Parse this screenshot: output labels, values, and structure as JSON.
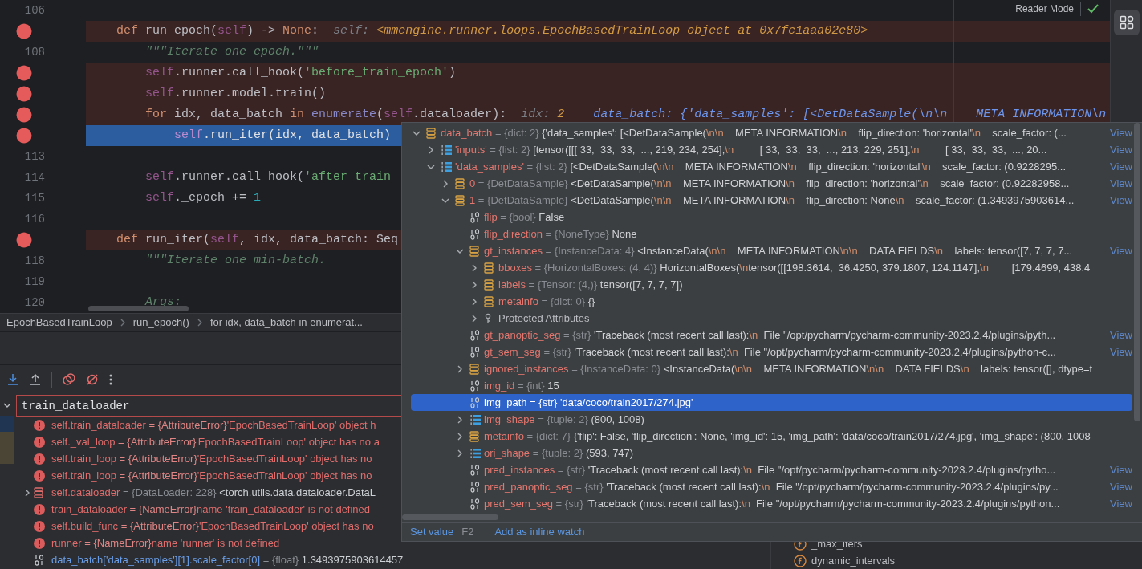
{
  "editor": {
    "reader_mode": "Reader Mode",
    "lines": [
      {
        "number": "106",
        "breakpoint": false,
        "execution": false
      },
      {
        "breakpoint": true,
        "execution": false,
        "tokens": [
          {
            "text": "    def",
            "kind": "kw"
          },
          {
            "text": " run_epoch(",
            "kind": "plain"
          },
          {
            "text": "self",
            "kind": "self"
          },
          {
            "text": ") -> ",
            "kind": "plain"
          },
          {
            "text": "None",
            "kind": "kw"
          },
          {
            "text": ":",
            "kind": "plain"
          }
        ],
        "hint": [
          {
            "text": "self: ",
            "kind": "label"
          },
          {
            "text": "<mmengine.runner.loops.EpochBasedTrainLoop object at 0x7fc1aaa02e80>",
            "kind": "value"
          }
        ]
      },
      {
        "number": "108",
        "breakpoint": false,
        "execution": false,
        "tokens": [
          {
            "text": "        \"\"\"Iterate one epoch.\"\"\"",
            "kind": "doc"
          }
        ]
      },
      {
        "breakpoint": true,
        "execution": false,
        "tokens": [
          {
            "text": "        self",
            "kind": "self"
          },
          {
            "text": ".runner.call_hook(",
            "kind": "plain"
          },
          {
            "text": "'before_train_epoch'",
            "kind": "str"
          },
          {
            "text": ")",
            "kind": "plain"
          }
        ]
      },
      {
        "breakpoint": true,
        "execution": false,
        "tokens": [
          {
            "text": "        self",
            "kind": "self"
          },
          {
            "text": ".runner.model.train()",
            "kind": "plain"
          }
        ]
      },
      {
        "breakpoint": true,
        "execution": false,
        "tokens": [
          {
            "text": "        for",
            "kind": "kw"
          },
          {
            "text": " idx, data_batch ",
            "kind": "plain"
          },
          {
            "text": "in",
            "kind": "kw"
          },
          {
            "text": " enumerate",
            "kind": "builtin"
          },
          {
            "text": "(",
            "kind": "plain"
          },
          {
            "text": "self",
            "kind": "self"
          },
          {
            "text": ".dataloader):",
            "kind": "plain"
          }
        ],
        "hint": [
          {
            "text": "idx: ",
            "kind": "label"
          },
          {
            "text": "2",
            "kind": "value"
          },
          {
            "text": "    data_batch: ",
            "kind": "changed-label"
          },
          {
            "text": "{'data_samples': [<DetDataSample(\\n\\n    META INFORMATION\\n",
            "kind": "changed-value"
          }
        ]
      },
      {
        "breakpoint": true,
        "execution": true,
        "tokens": [
          {
            "text": "            self",
            "kind": "self"
          },
          {
            "text": ".run_iter(idx, data_batch)",
            "kind": "plain"
          }
        ]
      },
      {
        "number": "113",
        "breakpoint": false,
        "execution": false
      },
      {
        "number": "114",
        "breakpoint": false,
        "execution": false,
        "tokens": [
          {
            "text": "        self",
            "kind": "self"
          },
          {
            "text": ".runner.call_hook(",
            "kind": "plain"
          },
          {
            "text": "'after_train_",
            "kind": "str"
          }
        ]
      },
      {
        "number": "115",
        "breakpoint": false,
        "execution": false,
        "tokens": [
          {
            "text": "        self",
            "kind": "self"
          },
          {
            "text": "._epoch += ",
            "kind": "plain"
          },
          {
            "text": "1",
            "kind": "num"
          }
        ]
      },
      {
        "number": "116",
        "breakpoint": false,
        "execution": false
      },
      {
        "breakpoint": true,
        "execution": false,
        "tokens": [
          {
            "text": "    def",
            "kind": "kw"
          },
          {
            "text": " run_iter(",
            "kind": "plain"
          },
          {
            "text": "self",
            "kind": "self"
          },
          {
            "text": ", idx, data_batch: Seq",
            "kind": "plain"
          }
        ]
      },
      {
        "number": "118",
        "breakpoint": false,
        "execution": false,
        "tokens": [
          {
            "text": "        \"\"\"Iterate one min-batch.",
            "kind": "doc"
          }
        ]
      },
      {
        "number": "119",
        "breakpoint": false,
        "execution": false
      },
      {
        "number": "120",
        "breakpoint": false,
        "execution": false,
        "tokens": [
          {
            "text": "        Args:",
            "kind": "doc"
          }
        ]
      }
    ]
  },
  "breadcrumbs": [
    "EpochBasedTrainLoop",
    "run_epoch()",
    "for idx, data_batch in enumerat..."
  ],
  "watches": {
    "input": {
      "value": "train_dataloader"
    },
    "rows": [
      {
        "kind": "error",
        "name": "self.train_dataloader",
        "sign": "=",
        "type": "{AttributeError}",
        "value": "'EpochBasedTrainLoop' object h"
      },
      {
        "kind": "error",
        "name": "self._val_loop",
        "sign": "=",
        "type": "{AttributeError}",
        "value": "'EpochBasedTrainLoop' object has no a"
      },
      {
        "kind": "error",
        "name": "self.train_loop",
        "sign": "=",
        "type": "{AttributeError}",
        "value": "'EpochBasedTrainLoop' object has no"
      },
      {
        "kind": "error",
        "name": "self.train_loop",
        "sign": "=",
        "type": "{AttributeError}",
        "value": "'EpochBasedTrainLoop' object has no"
      },
      {
        "kind": "object",
        "name": "self.dataloader",
        "sign": "=",
        "type": "{DataLoader: 228}",
        "value": "<torch.utils.data.dataloader.DataL",
        "expanded": false
      },
      {
        "kind": "error",
        "name": "train_dataloader",
        "sign": "=",
        "type": "{NameError}",
        "value": "name 'train_dataloader' is not defined"
      },
      {
        "kind": "error",
        "name": "self.build_func",
        "sign": "=",
        "type": "{AttributeError}",
        "value": "'EpochBasedTrainLoop' object has no"
      },
      {
        "kind": "error",
        "name": "runner",
        "sign": "=",
        "type": "{NameError}",
        "value": "name 'runner' is not defined"
      },
      {
        "kind": "value",
        "name": "data_batch['data_samples'][1].scale_factor[0]",
        "sign": "=",
        "type": "{float}",
        "value": "1.3493975903614457"
      }
    ]
  },
  "variables": [
    {
      "name": "_max_iters"
    },
    {
      "name": "dynamic_intervals"
    }
  ],
  "popup": {
    "tree": [
      {
        "kind": "dict",
        "name": "data_batch",
        "sign": "=",
        "type": "{dict: 2}",
        "value": "{'data_samples': [<DetDataSample(\\n\\n    META INFORMATION\\n    flip_direction: 'horizontal'\\n    scale_factor: (...",
        "view": "View",
        "expanded": true,
        "selected": false,
        "children": [
          {
            "kind": "list",
            "name": "'inputs'",
            "sign": "=",
            "type": "{list: 2}",
            "value": "[tensor([[[ 33,  33,  33,  ..., 219, 234, 254],\\n         [ 33,  33,  33,  ..., 213, 229, 251],\\n         [ 33,  33,  33,  ..., 20...",
            "view": "View",
            "expanded": false,
            "selected": false
          },
          {
            "kind": "list",
            "name": "'data_samples'",
            "sign": "=",
            "type": "{list: 2}",
            "value": "[<DetDataSample(\\n\\n    META INFORMATION\\n    flip_direction: 'horizontal'\\n    scale_factor: (0.9228295...",
            "view": "View",
            "expanded": true,
            "selected": false,
            "children": [
              {
                "kind": "dict",
                "name": "0",
                "sign": "=",
                "type": "{DetDataSample}",
                "value": "<DetDataSample(\\n\\n    META INFORMATION\\n    flip_direction: 'horizontal'\\n    scale_factor: (0.92282958...",
                "view": "View",
                "expanded": false,
                "selected": false
              },
              {
                "kind": "dict",
                "name": "1",
                "sign": "=",
                "type": "{DetDataSample}",
                "value": "<DetDataSample(\\n\\n    META INFORMATION\\n    flip_direction: None\\n    scale_factor: (1.3493975903614...",
                "view": "View",
                "expanded": true,
                "selected": false,
                "children": [
                  {
                    "kind": "scalar",
                    "name": "flip",
                    "sign": "=",
                    "type": "{bool}",
                    "value": "False",
                    "selected": false
                  },
                  {
                    "kind": "scalar",
                    "name": "flip_direction",
                    "sign": "=",
                    "type": "{NoneType}",
                    "value": "None",
                    "selected": false
                  },
                  {
                    "kind": "dict",
                    "name": "gt_instances",
                    "sign": "=",
                    "type": "{InstanceData: 4}",
                    "value": "<InstanceData(\\n\\n    META INFORMATION\\n\\n    DATA FIELDS\\n    labels: tensor([7, 7, 7, 7...",
                    "view": "View",
                    "expanded": true,
                    "selected": false,
                    "children": [
                      {
                        "kind": "dict",
                        "name": "bboxes",
                        "sign": "=",
                        "type": "{HorizontalBoxes: (4, 4)}",
                        "value": "HorizontalBoxes(\\ntensor([[198.3614,  36.4250, 379.1807, 124.1147],\\n        [179.4699, 438.4",
                        "expanded": false,
                        "selected": false
                      },
                      {
                        "kind": "dict",
                        "name": "labels",
                        "sign": "=",
                        "type": "{Tensor: (4,)}",
                        "value": "tensor([7, 7, 7, 7])",
                        "expanded": false,
                        "selected": false
                      },
                      {
                        "kind": "dict",
                        "name": "metainfo",
                        "sign": "=",
                        "type": "{dict: 0}",
                        "value": "{}",
                        "expanded": false,
                        "selected": false
                      },
                      {
                        "kind": "protected",
                        "name": "Protected Attributes",
                        "expanded": false,
                        "selected": false
                      }
                    ]
                  },
                  {
                    "kind": "scalar",
                    "name": "gt_panoptic_seg",
                    "sign": "=",
                    "type": "{str}",
                    "value": "'Traceback (most recent call last):\\n  File \"/opt/pycharm/pycharm-community-2023.2.4/plugins/pyth...",
                    "view": "View",
                    "selected": false
                  },
                  {
                    "kind": "scalar",
                    "name": "gt_sem_seg",
                    "sign": "=",
                    "type": "{str}",
                    "value": "'Traceback (most recent call last):\\n  File \"/opt/pycharm/pycharm-community-2023.2.4/plugins/python-c...",
                    "view": "View",
                    "selected": false
                  },
                  {
                    "kind": "dict",
                    "name": "ignored_instances",
                    "sign": "=",
                    "type": "{InstanceData: 0}",
                    "value": "<InstanceData(\\n\\n    META INFORMATION\\n\\n    DATA FIELDS\\n    labels: tensor([], dtype=t",
                    "expanded": false,
                    "selected": false
                  },
                  {
                    "kind": "scalar",
                    "name": "img_id",
                    "sign": "=",
                    "type": "{int}",
                    "value": "15",
                    "selected": false
                  },
                  {
                    "kind": "scalar",
                    "name": "img_path",
                    "sign": "=",
                    "type": "{str}",
                    "value": "'data/coco/train2017/274.jpg'",
                    "selected": true
                  },
                  {
                    "kind": "list",
                    "name": "img_shape",
                    "sign": "=",
                    "type": "{tuple: 2}",
                    "value": "(800, 1008)",
                    "expanded": false,
                    "selected": false
                  },
                  {
                    "kind": "dict",
                    "name": "metainfo",
                    "sign": "=",
                    "type": "{dict: 7}",
                    "value": "{'flip': False, 'flip_direction': None, 'img_id': 15, 'img_path': 'data/coco/train2017/274.jpg', 'img_shape': (800, 1008",
                    "expanded": false,
                    "selected": false
                  },
                  {
                    "kind": "list",
                    "name": "ori_shape",
                    "sign": "=",
                    "type": "{tuple: 2}",
                    "value": "(593, 747)",
                    "expanded": false,
                    "selected": false
                  },
                  {
                    "kind": "scalar",
                    "name": "pred_instances",
                    "sign": "=",
                    "type": "{str}",
                    "value": "'Traceback (most recent call last):\\n  File \"/opt/pycharm/pycharm-community-2023.2.4/plugins/pytho...",
                    "view": "View",
                    "selected": false
                  },
                  {
                    "kind": "scalar",
                    "name": "pred_panoptic_seg",
                    "sign": "=",
                    "type": "{str}",
                    "value": "'Traceback (most recent call last):\\n  File \"/opt/pycharm/pycharm-community-2023.2.4/plugins/py...",
                    "view": "View",
                    "selected": false
                  },
                  {
                    "kind": "scalar",
                    "name": "pred_sem_seg",
                    "sign": "=",
                    "type": "{str}",
                    "value": "'Traceback (most recent call last):\\n  File \"/opt/pycharm/pycharm-community-2023.2.4/plugins/python...",
                    "view": "View",
                    "selected": false
                  }
                ]
              }
            ]
          }
        ]
      }
    ],
    "actions": [
      {
        "label": "Set value",
        "shortcut": "F2"
      },
      {
        "label": "Add as inline watch"
      }
    ]
  }
}
